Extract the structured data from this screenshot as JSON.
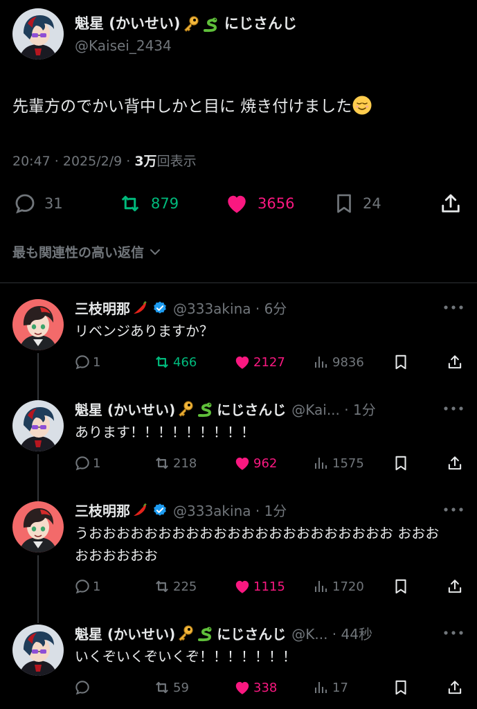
{
  "main_tweet": {
    "name": "魁星 (かいせい)",
    "name_suffix": "にじさんじ",
    "handle": "@Kaisei_2434",
    "text": "先輩方のでかい背中しかと目に 焼き付けました",
    "time": "20:47 · 2025/2/9 · ",
    "views_bold": "3万",
    "views_label": "回表示",
    "replies": "31",
    "retweets": "879",
    "likes": "3656",
    "bookmarks": "24"
  },
  "sort_label": "最も関連性の高い返信",
  "replies": [
    {
      "name": "三枝明那",
      "handle": "@333akina · 6分",
      "text": "リベンジありますか？",
      "replies": "1",
      "retweets": "466",
      "likes": "2127",
      "views": "9836",
      "retweet_active": true
    },
    {
      "name": "魁星 (かいせい)",
      "name_suffix": "にじさんじ",
      "handle": "@Kai... · 1分",
      "text": "あります！！！！！！！！！",
      "replies": "1",
      "retweets": "218",
      "likes": "962",
      "views": "1575",
      "retweet_active": false
    },
    {
      "name": "三枝明那",
      "handle": "@333akina · 1分",
      "text": "うおおおおおおおおおおおおおおおおおおおおおお おおおおおおおおお",
      "replies": "1",
      "retweets": "225",
      "likes": "1115",
      "views": "1720",
      "retweet_active": false
    },
    {
      "name": "魁星 (かいせい)",
      "name_suffix": "にじさんじ",
      "handle": "@K... · 44秒",
      "text": "いくぞいくぞいくぞ！！！！！！！",
      "replies": "",
      "retweets": "59",
      "likes": "338",
      "views": "17",
      "retweet_active": false
    }
  ],
  "colors": {
    "like": "#f91880",
    "retweet": "#00ba7c",
    "muted": "#71767b",
    "verified": "#1d9bf0"
  },
  "icons": [
    "reply-icon",
    "retweet-icon",
    "like-icon",
    "bookmark-icon",
    "share-icon",
    "views-icon",
    "more-icon",
    "verified-icon",
    "key-icon",
    "snake-icon",
    "pepper-icon",
    "chevron-down-icon"
  ]
}
